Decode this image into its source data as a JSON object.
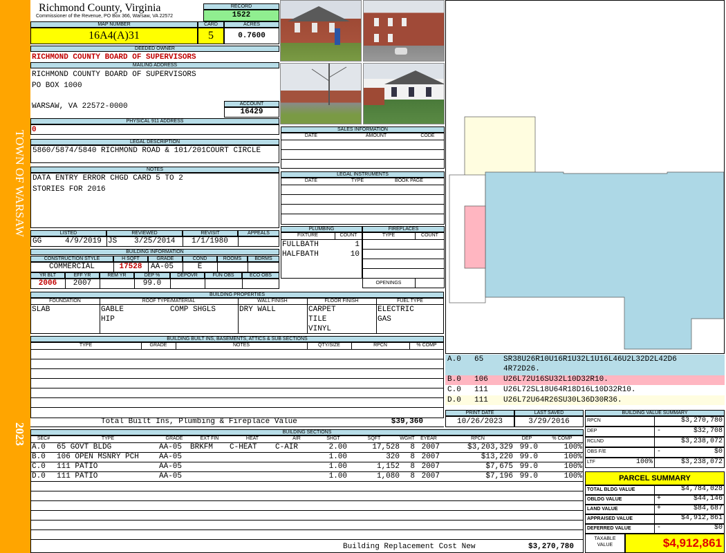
{
  "sidebar": {
    "town": "TOWN OF WARSAW",
    "year": "2023"
  },
  "header": {
    "county": "Richmond County, Virginia",
    "commissioner": "Commissioner of the Revenue, PO Box 366, Warsaw, VA 22572",
    "record_label": "RECORD",
    "record": "1522",
    "map_label": "MAP NUMBER",
    "map_number": "16A4(A)31",
    "card_label": "CARD",
    "card": "5",
    "acres_label": "ACRES",
    "acres": "0.7600"
  },
  "owner": {
    "deeded_label": "DEEDED OWNER",
    "deeded": "RICHMOND COUNTY BOARD OF SUPERVISORS",
    "mailing_label": "MAILING ADDRESS",
    "mail_line1": "RICHMOND COUNTY BOARD OF SUPERVISORS",
    "mail_line2": "PO BOX  1000",
    "mail_line3": "WARSAW, VA 22572-0000",
    "account_label": "ACCOUNT",
    "account": "16429",
    "phys_label": "PHYSICAL 911 ADDRESS",
    "phys": "0"
  },
  "legal": {
    "label": "LEGAL DESCRIPTION",
    "text": "5860/5874/5840 RICHMOND ROAD & 101/201COURT CIRCLE"
  },
  "notes": {
    "label": "NOTES",
    "line1": "DATA ENTRY ERROR CHGD CARD 5 TO 2",
    "line2": "STORIES FOR 2016"
  },
  "listed": {
    "listed_label": "LISTED",
    "reviewed_label": "REVIEWED",
    "revisit_label": "REVISIT",
    "appeals_label": "APPEALS",
    "listed_by": "GG",
    "listed_date": "4/9/2019",
    "reviewed_by": "JS",
    "reviewed_date": "3/25/2014",
    "revisit": "1/1/1980"
  },
  "building_info": {
    "label": "BUILDING INFORMATION",
    "h_style": "CONSTRUCTION STYLE",
    "h_sqft": "H SQFT",
    "h_grade": "GRADE",
    "h_cond": "COND",
    "h_rooms": "ROOMS",
    "h_bdrms": "BDRMS",
    "style": "COMMERCIAL",
    "sqft": "17528",
    "grade": "AA-05",
    "cond": "E",
    "h_yrblt": "YR BLT",
    "h_effyr": "EFF YR",
    "h_remyr": "REM YR",
    "h_dep": "DEP %",
    "h_depovr": "DEPOVR",
    "h_funobs": "FUN OBS",
    "h_ecoobs": "ECO OBS",
    "yrblt": "2006",
    "effyr": "2007",
    "dep": "99.0"
  },
  "sales": {
    "label": "SALES INFORMATION",
    "h_date": "DATE",
    "h_amount": "AMOUNT",
    "h_code": "CODE"
  },
  "instruments": {
    "label": "LEGAL INSTRUMENTS",
    "h_date": "DATE",
    "h_type": "TYPE",
    "h_book": "BOOK PAGE"
  },
  "plumbing": {
    "label": "PLUMBING",
    "h_fixture": "FIXTURE",
    "h_count": "COUNT",
    "rows": [
      {
        "fixture": "FULLBATH",
        "count": "1"
      },
      {
        "fixture": "HALFBATH",
        "count": "10"
      }
    ]
  },
  "fireplaces": {
    "label": "FIREPLACES",
    "h_type": "TYPE",
    "h_count": "COUNT",
    "openings": "OPENINGS"
  },
  "properties": {
    "label": "BUILDING PROPERTIES",
    "h_foundation": "FOUNDATION",
    "h_roof": "ROOF TYPE/MATERIAL",
    "h_wall": "WALL FINISH",
    "h_floor": "FLOOR FINISH",
    "h_fuel": "FUEL TYPE",
    "foundation": "SLAB",
    "roof1": "GABLE",
    "roof_mat": "COMP SHGLS",
    "roof2": "HIP",
    "wall": "DRY WALL",
    "floor1": "CARPET",
    "floor2": "TILE",
    "floor3": "VINYL",
    "fuel1": "ELECTRIC",
    "fuel2": "GAS"
  },
  "builtins": {
    "label": "BUILDING BUILT INS, BASEMENTS, ATTICS & SUB SECTIONS",
    "h_type": "TYPE",
    "h_grade": "GRADE",
    "h_notes": "NOTES",
    "h_qty": "QTY/SIZE",
    "h_rpcn": "RPCN",
    "h_comp": "% COMP",
    "total_label": "Total Built Ins, Plumbing & Fireplace Value",
    "total": "$39,360"
  },
  "sketch_codes": [
    {
      "id": "A.0",
      "code": "65",
      "path": "SR38U26R10U16R1U32L1U16L46U2L32D2L42D6",
      "path2": "4R72D26.",
      "color": "#b7dde8"
    },
    {
      "id": "B.0",
      "code": "106",
      "path": "U26L72U16SU32L10D32R10.",
      "color": "#ffb6c1"
    },
    {
      "id": "C.0",
      "code": "111",
      "path": "U26L72SL18U64R18D16L10D32R10.",
      "color": "#ffffff"
    },
    {
      "id": "D.0",
      "code": "111",
      "path": "U26L72U64R26SU30L36D30R36.",
      "color": "#fffde0"
    }
  ],
  "dates": {
    "print_label": "PRINT DATE",
    "print": "10/26/2023",
    "saved_label": "LAST SAVED",
    "saved": "3/29/2016"
  },
  "sections": {
    "label": "BUILDING SECTIONS",
    "headers": [
      "SEC#",
      "TYPE",
      "GRADE",
      "EXT FIN",
      "HEAT",
      "AIR",
      "SHGT",
      "SQFT",
      "WGHT",
      "EYEAR",
      "RPCN",
      "DEP",
      "% COMP"
    ],
    "rows": [
      [
        "A.0",
        "65 GOVT BLDG",
        "AA-05",
        "BRKFM",
        "C-HEAT",
        "C-AIR",
        "2.00",
        "17,528",
        "8",
        "2007",
        "$3,203,329",
        "99.0",
        "100%"
      ],
      [
        "B.0",
        "106 OPEN MSNRY PCH",
        "AA-05",
        "",
        "",
        "",
        "1.00",
        "320",
        "8",
        "2007",
        "$13,220",
        "99.0",
        "100%"
      ],
      [
        "C.0",
        "111 PATIO",
        "AA-05",
        "",
        "",
        "",
        "1.00",
        "1,152",
        "8",
        "2007",
        "$7,675",
        "99.0",
        "100%"
      ],
      [
        "D.0",
        "111 PATIO",
        "AA-05",
        "",
        "",
        "",
        "1.00",
        "1,080",
        "8",
        "2007",
        "$7,196",
        "99.0",
        "100%"
      ]
    ],
    "replacement_label": "Building Replacement Cost New",
    "replacement": "$3,270,780"
  },
  "value_summary": {
    "label": "BUILDING VALUE SUMMARY",
    "rows": [
      {
        "label": "RPCN",
        "sign": "",
        "pct": "",
        "value": "$3,270,780"
      },
      {
        "label": "DEP",
        "sign": "-",
        "pct": "",
        "value": "$32,708"
      },
      {
        "label": "RCLND",
        "sign": "",
        "pct": "",
        "value": "$3,238,072"
      },
      {
        "label": "OBS F/E",
        "sign": "-",
        "pct": "",
        "value": "$0"
      },
      {
        "label": "LTF",
        "sign": "",
        "pct": "100%",
        "value": "$3,238,072"
      }
    ]
  },
  "parcel": {
    "label": "PARCEL SUMMARY",
    "rows": [
      {
        "label": "TOTAL BLDG VALUE",
        "sign": "",
        "value": "$4,784,028"
      },
      {
        "label": "OBLDG VALUE",
        "sign": "+",
        "value": "$44,146"
      },
      {
        "label": "LAND VALUE",
        "sign": "+",
        "value": "$84,687"
      },
      {
        "label": "APPRAISED VALUE",
        "sign": "",
        "value": "$4,912,861"
      },
      {
        "label": "DEFERRED VALUE",
        "sign": "-",
        "value": "$0"
      }
    ],
    "taxable_label1": "TAXABLE",
    "taxable_label2": "VALUE",
    "taxable": "$4,912,861"
  },
  "colors": {
    "sidebar": "#ffa500",
    "header_band": "#b7dde8",
    "yellow": "#ffff00",
    "record_green": "#90ee90",
    "sketch_main": "#add8e6",
    "sketch_pink": "#ffb6c1",
    "sketch_cream": "#fffde0"
  }
}
